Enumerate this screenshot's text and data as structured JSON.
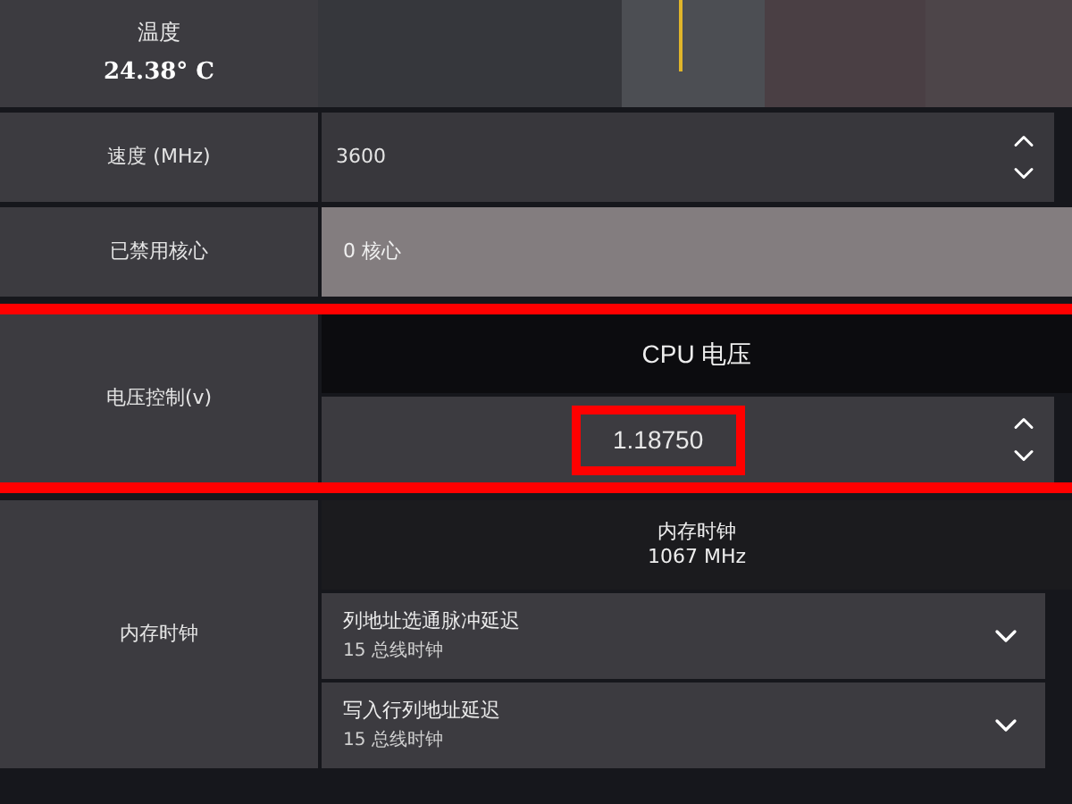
{
  "temperature": {
    "label": "温度",
    "value": "24.38° C"
  },
  "speed": {
    "label": "速度 (MHz)",
    "value": "3600"
  },
  "disabled_cores": {
    "label": "已禁用核心",
    "value": "0 核心"
  },
  "voltage": {
    "label": "电压控制(v)",
    "title": "CPU 电压",
    "value": "1.18750",
    "highlighted": true
  },
  "memory": {
    "label": "内存时钟",
    "title": "内存时钟",
    "subtitle": "1067 MHz",
    "timings": [
      {
        "name": "列地址选通脉冲延迟",
        "value": "15 总线时钟"
      },
      {
        "name": "写入行列地址延迟",
        "value": "15 总线时钟"
      }
    ]
  }
}
